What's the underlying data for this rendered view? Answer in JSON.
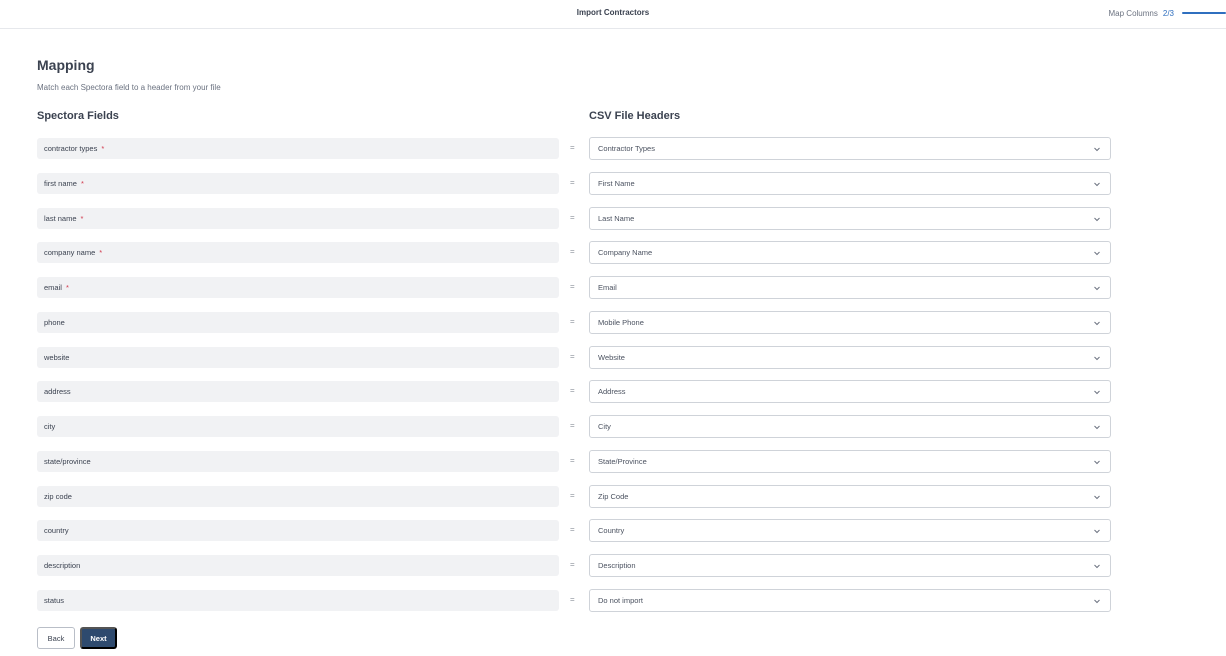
{
  "header": {
    "title": "Import Contractors",
    "step_label": "Map Columns",
    "step_count": "2/3",
    "progress_fraction": 0.67
  },
  "page": {
    "heading": "Mapping",
    "subheading": "Match each Spectora field to a header from your file",
    "left_column_title": "Spectora Fields",
    "right_column_title": "CSV File Headers",
    "equals": "="
  },
  "mappings": [
    {
      "field": "contractor types",
      "required": true,
      "header": "Contractor Types"
    },
    {
      "field": "first name",
      "required": true,
      "header": "First Name"
    },
    {
      "field": "last name",
      "required": true,
      "header": "Last Name"
    },
    {
      "field": "company name",
      "required": true,
      "header": "Company Name"
    },
    {
      "field": "email",
      "required": true,
      "header": "Email"
    },
    {
      "field": "phone",
      "required": false,
      "header": "Mobile Phone"
    },
    {
      "field": "website",
      "required": false,
      "header": "Website"
    },
    {
      "field": "address",
      "required": false,
      "header": "Address"
    },
    {
      "field": "city",
      "required": false,
      "header": "City"
    },
    {
      "field": "state/province",
      "required": false,
      "header": "State/Province"
    },
    {
      "field": "zip code",
      "required": false,
      "header": "Zip Code"
    },
    {
      "field": "country",
      "required": false,
      "header": "Country"
    },
    {
      "field": "description",
      "required": false,
      "header": "Description"
    },
    {
      "field": "status",
      "required": false,
      "header": "Do not import"
    }
  ],
  "required_marker": "*",
  "buttons": {
    "back": "Back",
    "next": "Next"
  },
  "colors": {
    "accent": "#2f6fbf",
    "primary_button": "#2e4a6e",
    "required": "#d0364a"
  }
}
